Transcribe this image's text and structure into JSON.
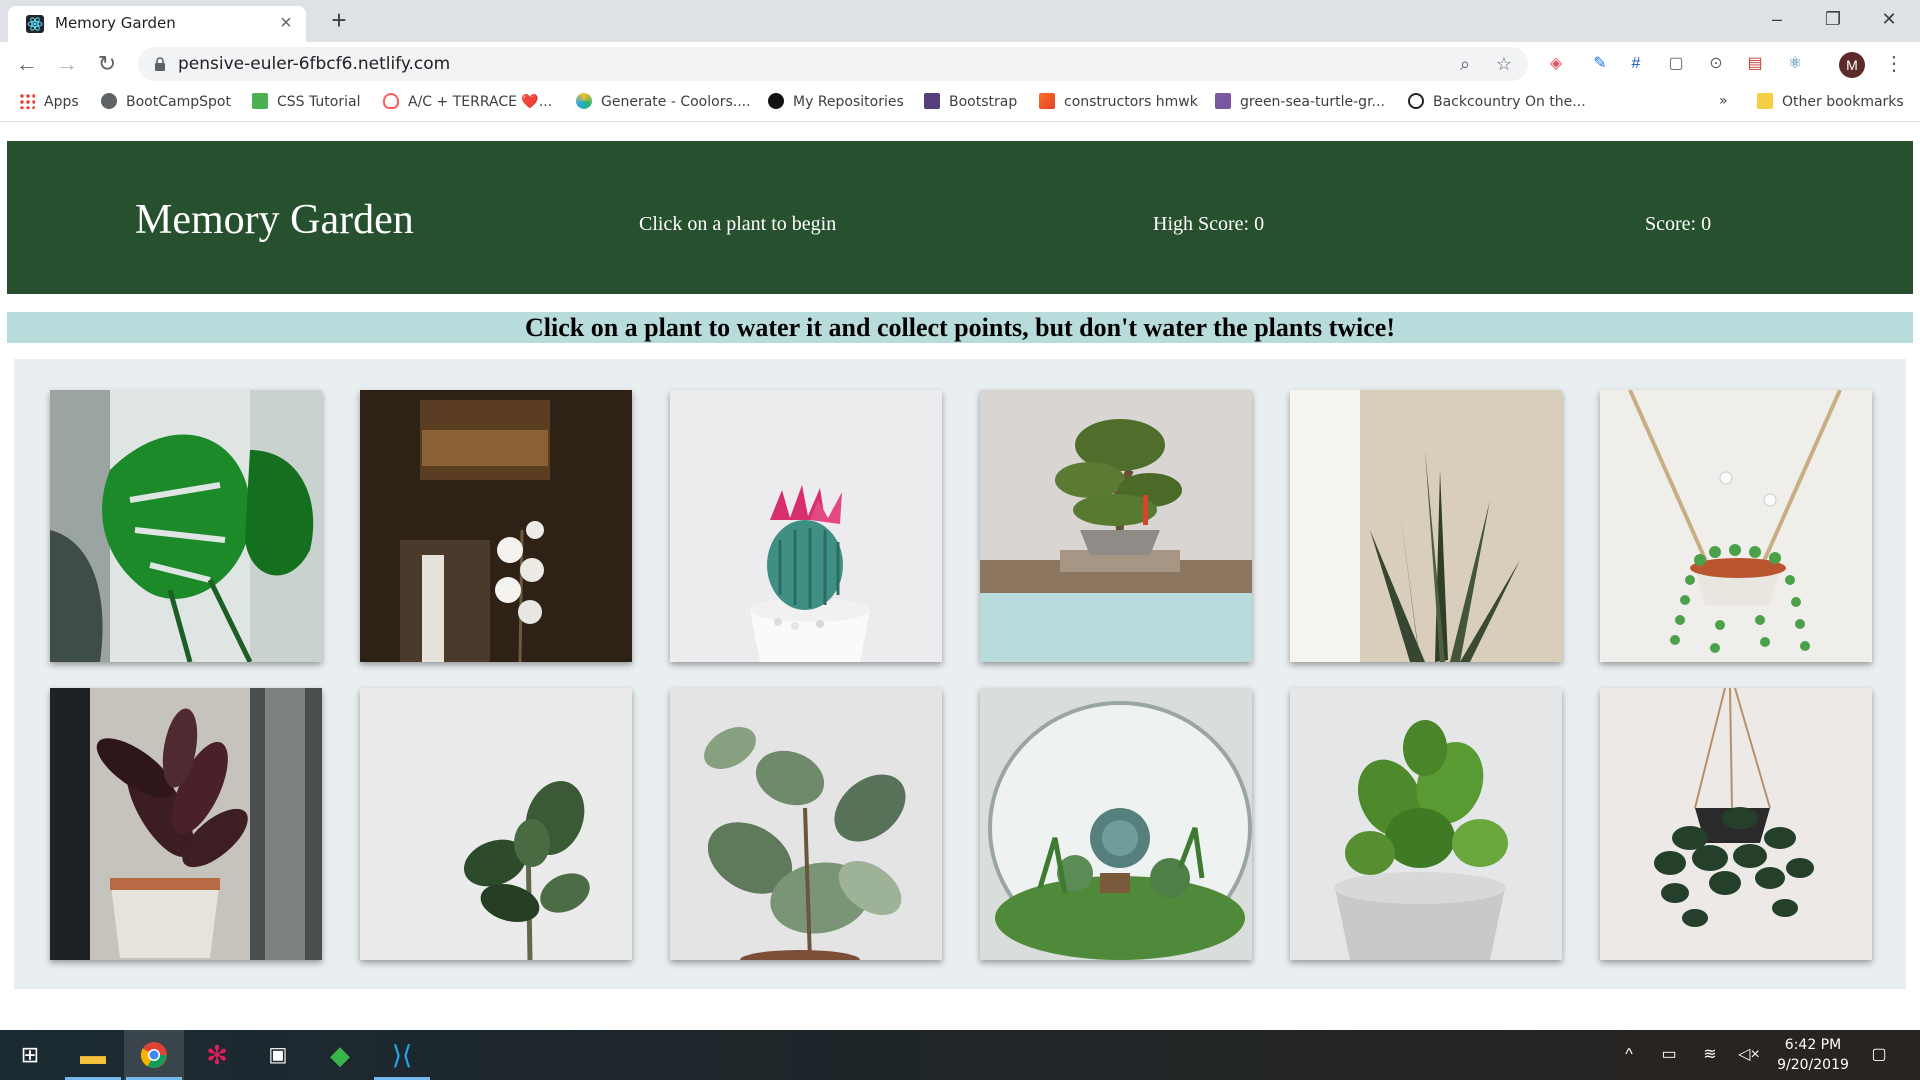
{
  "browser": {
    "tab_title": "Memory Garden",
    "tab_close_icon": "close-icon",
    "new_tab_icon": "plus-icon",
    "url": "pensive-euler-6fbcf6.netlify.com",
    "bookmarks": [
      {
        "label": "Apps",
        "icon": "apps-grid-icon"
      },
      {
        "label": "BootCampSpot",
        "icon": "globe-icon"
      },
      {
        "label": "CSS Tutorial",
        "icon": "w3-icon"
      },
      {
        "label": "A/C + TERRACE ❤️...",
        "icon": "airbnb-icon"
      },
      {
        "label": "Generate - Coolors....",
        "icon": "coolors-icon"
      },
      {
        "label": "My Repositories",
        "icon": "github-icon"
      },
      {
        "label": "Bootstrap",
        "icon": "bootstrap-icon"
      },
      {
        "label": "constructors hmwk",
        "icon": "gitlab-icon"
      },
      {
        "label": "green-sea-turtle-gr...",
        "icon": "heroku-icon"
      },
      {
        "label": "Backcountry On the...",
        "icon": "backcountry-icon"
      }
    ],
    "bookmarks_overflow": "»",
    "other_bookmarks": "Other bookmarks",
    "profile_initial": "M"
  },
  "header": {
    "title": "Memory Garden",
    "message": "Click on a plant to begin",
    "high_score": "High Score: 0",
    "score": "Score: 0"
  },
  "instructions": "Click on a plant to water it and collect points, but don't water the plants twice!",
  "plants": [
    {
      "name": "monstera"
    },
    {
      "name": "white-orchid"
    },
    {
      "name": "flowering-cactus"
    },
    {
      "name": "bonsai-tree"
    },
    {
      "name": "snake-plant"
    },
    {
      "name": "string-of-pearls"
    },
    {
      "name": "rubber-plant-burgundy"
    },
    {
      "name": "fiddle-leaf-fig"
    },
    {
      "name": "variegated-rubber-plant"
    },
    {
      "name": "succulent-terrarium"
    },
    {
      "name": "basil"
    },
    {
      "name": "hanging-pothos"
    }
  ],
  "taskbar": {
    "time": "6:42 PM",
    "date": "9/20/2019"
  },
  "colors": {
    "header_bg": "#27502f",
    "instruction_bg": "#b8dcdb",
    "garden_bg": "#e9eef0"
  }
}
